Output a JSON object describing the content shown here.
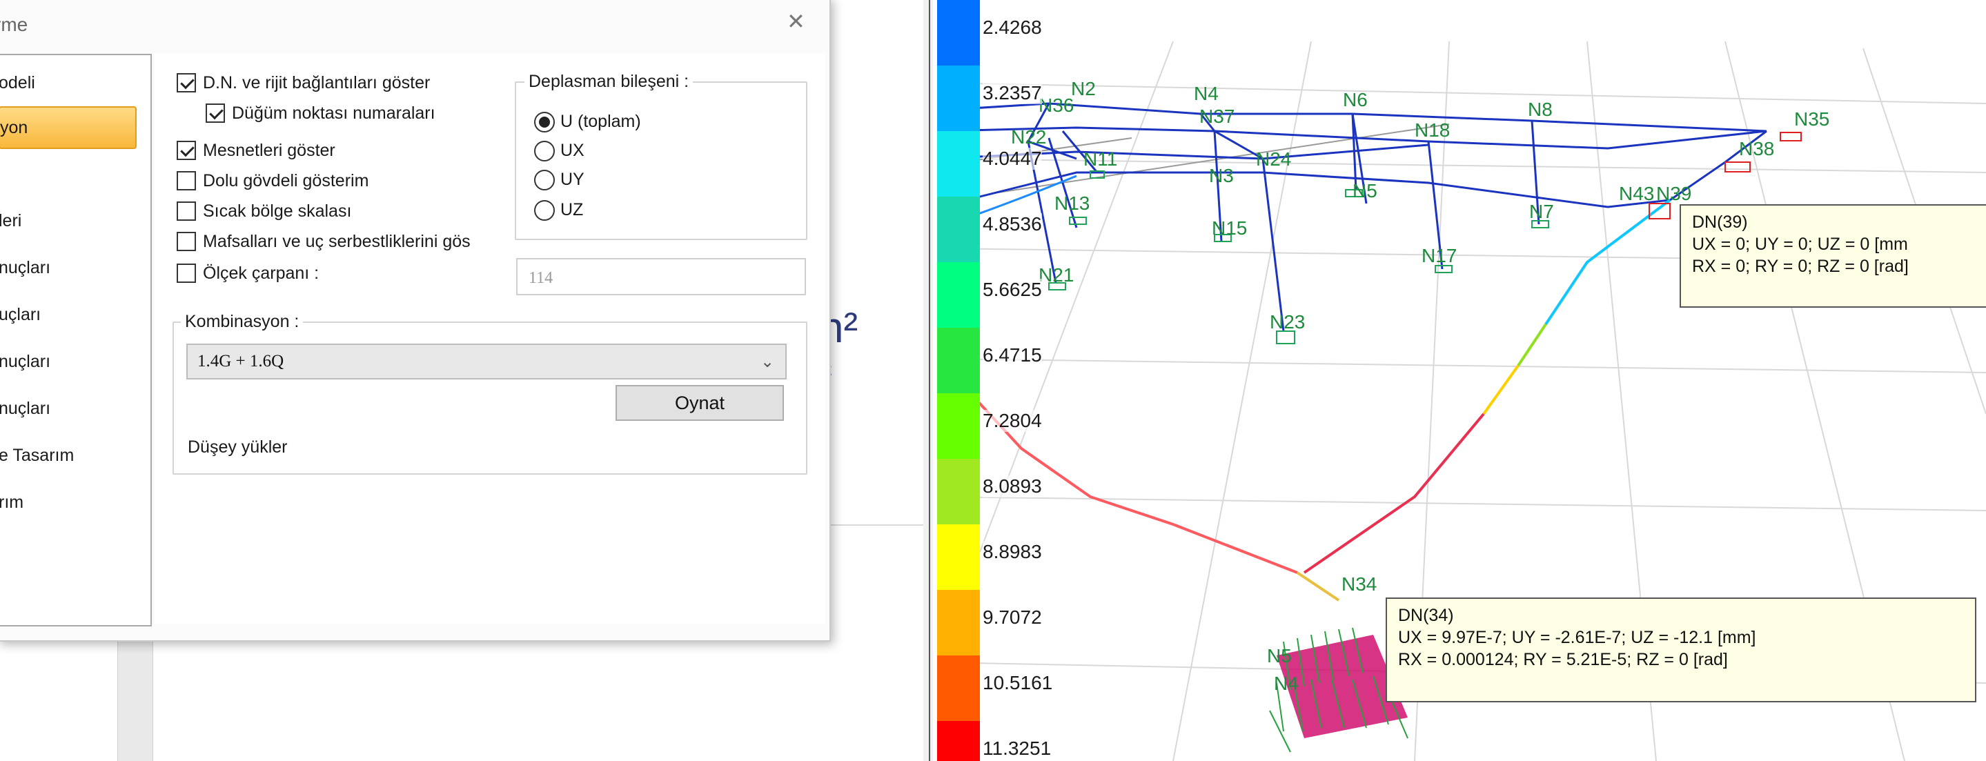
{
  "dialog": {
    "title": "rme",
    "close_glyph": "✕",
    "nav_items": [
      {
        "label": "odeli"
      },
      {
        "label": "yon",
        "active": true
      },
      {
        "label": "leri"
      },
      {
        "label": "nuçları"
      },
      {
        "label": "uçları"
      },
      {
        "label": "nuçları"
      },
      {
        "label": "nuçları"
      },
      {
        "label": "e Tasarım"
      },
      {
        "label": "rım"
      }
    ],
    "options": {
      "show_nodes": {
        "label": "D.N. ve rijit bağlantıları göster",
        "checked": true
      },
      "node_numbers": {
        "label": "Düğüm noktası numaraları",
        "checked": true
      },
      "show_supports": {
        "label": "Mesnetleri göster",
        "checked": true
      },
      "solid_display": {
        "label": "Dolu gövdeli gösterim",
        "checked": false
      },
      "hotspot_scale": {
        "label": "Sıcak bölge skalası",
        "checked": false
      },
      "hinges": {
        "label": "Mafsalları ve uç serbestliklerini  gös",
        "checked": false
      },
      "scale_factor": {
        "label": "Ölçek çarpanı :",
        "checked": false,
        "value": "114"
      }
    },
    "displacement": {
      "title": "Deplasman bileşeni :",
      "options": [
        {
          "label": "U (toplam)",
          "selected": true
        },
        {
          "label": "UX",
          "selected": false
        },
        {
          "label": "UY",
          "selected": false
        },
        {
          "label": "UZ",
          "selected": false
        }
      ]
    },
    "combination": {
      "title": "Kombinasyon :",
      "selected": "1.4G + 1.6Q",
      "play_button": "Oynat",
      "note": "Düşey yükler"
    }
  },
  "background": {
    "math_text1": "n²",
    "math_text2": "²"
  },
  "legend": {
    "labels": [
      "2.4268",
      "3.2357",
      "4.0447",
      "4.8536",
      "5.6625",
      "6.4715",
      "7.2804",
      "8.0893",
      "8.8983",
      "9.7072",
      "10.5161",
      "11.3251"
    ],
    "colors": [
      "#0070ff",
      "#00b0ff",
      "#10e8f0",
      "#18d8b0",
      "#00ff80",
      "#28e640",
      "#66ff00",
      "#a0e820",
      "#ffff00",
      "#ffb000",
      "#ff5a00",
      "#ff0000"
    ]
  },
  "nodes": [
    "N2",
    "N4",
    "N6",
    "N8",
    "N35",
    "N36",
    "N37",
    "N22",
    "N18",
    "N38",
    "N11",
    "N24",
    "N43",
    "N39",
    "N3",
    "N5",
    "N13",
    "N7",
    "N15",
    "N17",
    "N21",
    "N23",
    "N34",
    "N5",
    "N4"
  ],
  "tooltips": {
    "dn39": {
      "title": "DN(39)",
      "line1": "UX = 0; UY = 0; UZ = 0   [mm",
      "line2": "RX = 0; RY = 0; RZ = 0   [rad]"
    },
    "dn34": {
      "title": "DN(34)",
      "line1": "UX = 9.97E-7; UY = -2.61E-7; UZ = -12.1   [mm]",
      "line2": "RX = 0.000124; RY = 5.21E-5; RZ = 0   [rad]"
    }
  }
}
